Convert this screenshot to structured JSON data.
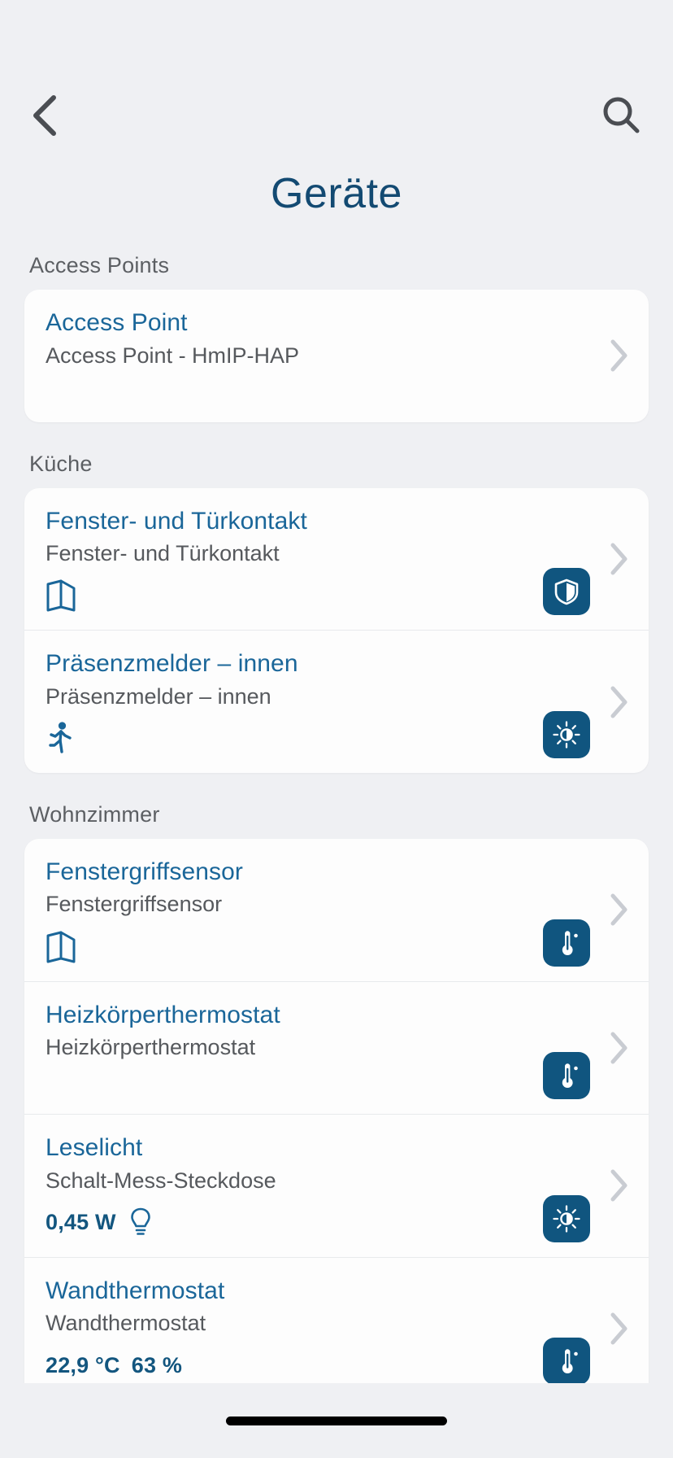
{
  "nav": {
    "back_icon": "chevron-left-icon",
    "search_icon": "search-icon",
    "title": "Geräte"
  },
  "colors": {
    "accent": "#1a6699",
    "title": "#134a72",
    "badge_bg": "#10557f",
    "value": "#13567f",
    "page_bg": "#eff0f3",
    "card_bg": "#fdfdfd",
    "secondary_text": "#56595d",
    "chevron": "#c9ccd2"
  },
  "sections": [
    {
      "header": "Access Points",
      "devices": [
        {
          "name": "Access Point",
          "type": "Access Point - HmIP-HAP",
          "status_icon": "",
          "status_values": [],
          "badge_icon": ""
        }
      ]
    },
    {
      "header": "Küche",
      "devices": [
        {
          "name": "Fenster- und Türkontakt",
          "type": "Fenster- und Türkontakt",
          "status_icon": "window-open-icon",
          "status_values": [],
          "badge_icon": "shield-icon"
        },
        {
          "name": "Präsenzmelder – innen",
          "type": "Präsenzmelder – innen",
          "status_icon": "motion-running-icon",
          "status_values": [],
          "badge_icon": "brightness-sun-icon"
        }
      ]
    },
    {
      "header": "Wohnzimmer",
      "devices": [
        {
          "name": "Fenstergriffsensor",
          "type": "Fenstergriffsensor",
          "status_icon": "window-open-icon",
          "status_values": [],
          "badge_icon": "thermometer-icon"
        },
        {
          "name": "Heizkörperthermostat",
          "type": "Heizkörperthermostat",
          "status_icon": "",
          "status_values": [],
          "badge_icon": "thermometer-icon"
        },
        {
          "name": "Leselicht",
          "type": "Schalt-Mess-Steckdose",
          "status_icon": "lightbulb-icon",
          "status_values": [
            "0,45 W"
          ],
          "badge_icon": "brightness-sun-icon"
        },
        {
          "name": "Wandthermostat",
          "type": "Wandthermostat",
          "status_icon": "",
          "status_values": [
            "22,9 °C",
            "63 %"
          ],
          "badge_icon": "thermometer-icon"
        }
      ]
    }
  ],
  "home_indicator": "home-indicator"
}
